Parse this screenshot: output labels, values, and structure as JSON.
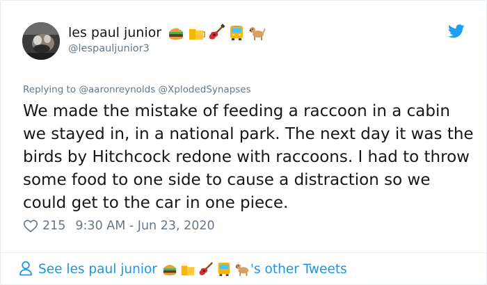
{
  "author": {
    "display_name": "les paul junior",
    "handle": "@lespauljunior3",
    "emojis": [
      "hamburger-emoji",
      "beer-mugs-emoji",
      "guitar-emoji",
      "bus-emoji",
      "dog-emoji"
    ]
  },
  "reply": {
    "prefix": "Replying to",
    "mentions": [
      "@aaronreynolds",
      "@XplodedSynapses"
    ]
  },
  "tweet": {
    "text": "We made the mistake of feeding a raccoon in a cabin we stayed in, in a national park. The next day it was the birds by Hitchcock redone with raccoons. I had to throw some food to one side to cause a distraction so we could get to the car in one piece.",
    "like_count": "215",
    "timestamp": "9:30 AM - Jun 23, 2020"
  },
  "footer": {
    "prefix": "See les paul junior",
    "suffix": "'s other Tweets"
  },
  "colors": {
    "twitter_blue": "#1da1f2",
    "link_blue": "#1b95e0",
    "muted_gray": "#657786",
    "text_dark": "#14171a",
    "border": "#e6ecf0"
  }
}
